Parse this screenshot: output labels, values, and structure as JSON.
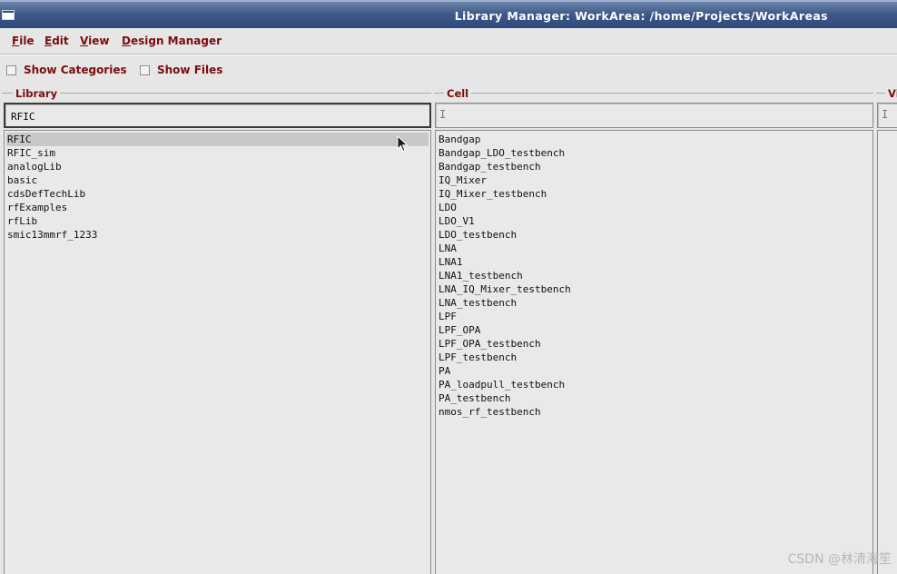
{
  "window": {
    "title": "Library Manager: WorkArea: /home/Projects/WorkAreas"
  },
  "menu": [
    {
      "ul": "F",
      "rest": "ile"
    },
    {
      "ul": "E",
      "rest": "dit"
    },
    {
      "ul": "V",
      "rest": "iew"
    },
    {
      "ul": "D",
      "rest": "esign Manager"
    }
  ],
  "options": {
    "show_categories": {
      "label": "Show Categories",
      "checked": false
    },
    "show_files": {
      "label": "Show Files",
      "checked": false
    }
  },
  "library": {
    "label": "Library",
    "filter_value": "RFIC",
    "items": [
      "RFIC",
      "RFIC_sim",
      "analogLib",
      "basic",
      "cdsDefTechLib",
      "rfExamples",
      "rfLib",
      "smic13mmrf_1233"
    ],
    "selected": "RFIC"
  },
  "cell": {
    "label": "Cell",
    "filter_value": "",
    "items": [
      "Bandgap",
      "Bandgap_LDO_testbench",
      "Bandgap_testbench",
      "IQ_Mixer",
      "IQ_Mixer_testbench",
      "LDO",
      "LDO_V1",
      "LDO_testbench",
      "LNA",
      "LNA1",
      "LNA1_testbench",
      "LNA_IQ_Mixer_testbench",
      "LNA_testbench",
      "LPF",
      "LPF_OPA",
      "LPF_OPA_testbench",
      "LPF_testbench",
      "PA",
      "PA_loadpull_testbench",
      "PA_testbench",
      "nmos_rf_testbench"
    ]
  },
  "view": {
    "label": "Vi"
  },
  "watermark": "CSDN @林清海笙",
  "colors": {
    "title_bar": "#3f5a8a",
    "label_red": "#7a0d0d",
    "background": "#e6e6e6"
  }
}
